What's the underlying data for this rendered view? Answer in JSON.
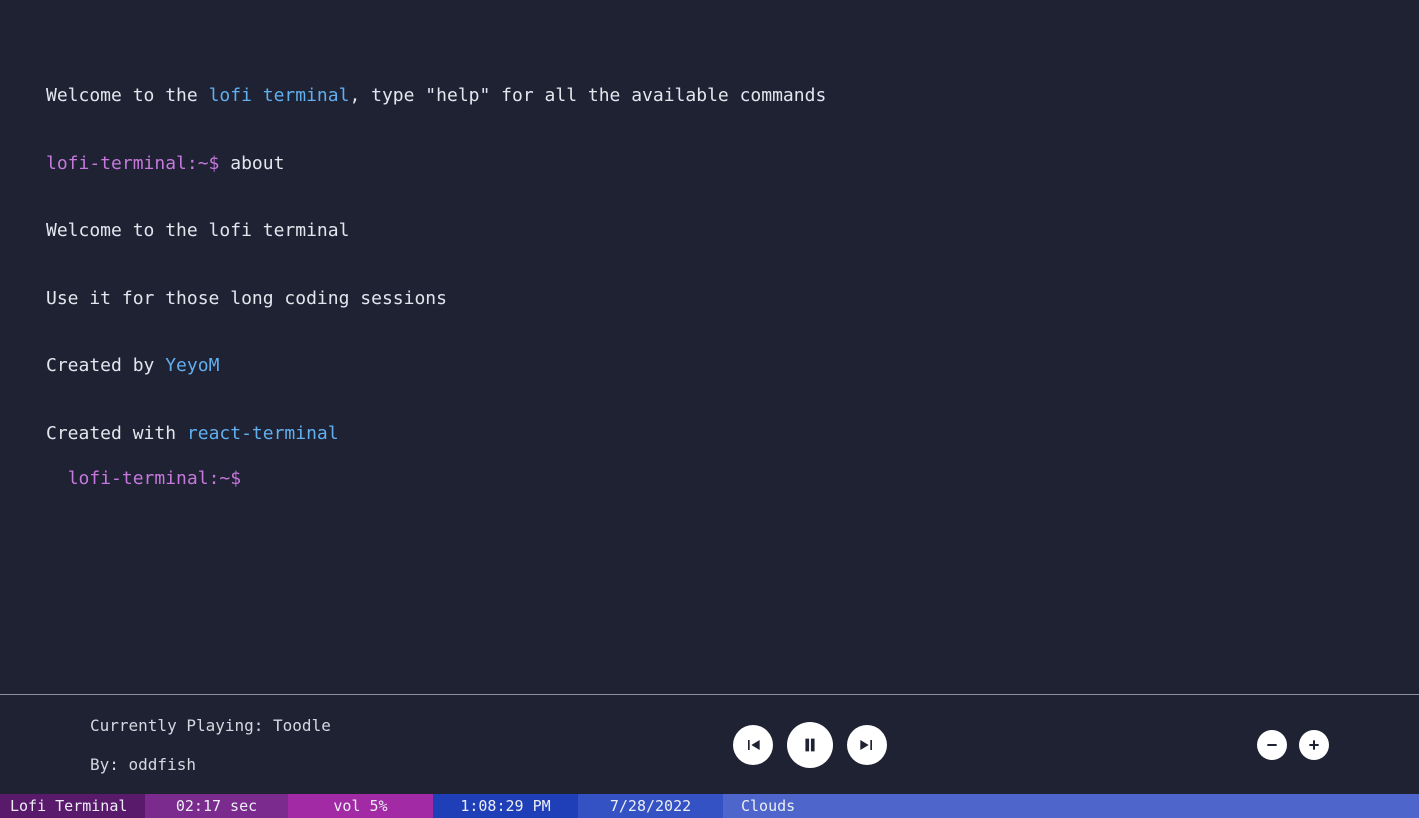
{
  "terminal": {
    "welcome_prefix": "Welcome to the ",
    "welcome_link": "lofi terminal",
    "welcome_suffix": ", type \"help\" for all the available commands",
    "prompt": "lofi-terminal:~$",
    "entered_cmd": "about",
    "about_line1": "Welcome to the lofi terminal",
    "about_line2": "Use it for those long coding sessions",
    "about_line3_prefix": "Created by ",
    "about_line3_link": "YeyoM",
    "about_line4_prefix": "Created with ",
    "about_line4_link": "react-terminal"
  },
  "player": {
    "now_playing_label": "Currently Playing: ",
    "track": "Toodle",
    "by_label": "By: ",
    "artist": "oddfish"
  },
  "status": {
    "title": "Lofi Terminal",
    "elapsed": "02:17 sec",
    "volume": "vol 5%",
    "time": "1:08:29 PM",
    "date": "7/28/2022",
    "weather": "Clouds"
  },
  "colors": {
    "bg": "#1e2233",
    "text": "#e4e6ed",
    "link": "#61afef",
    "prompt": "#c678dd"
  }
}
